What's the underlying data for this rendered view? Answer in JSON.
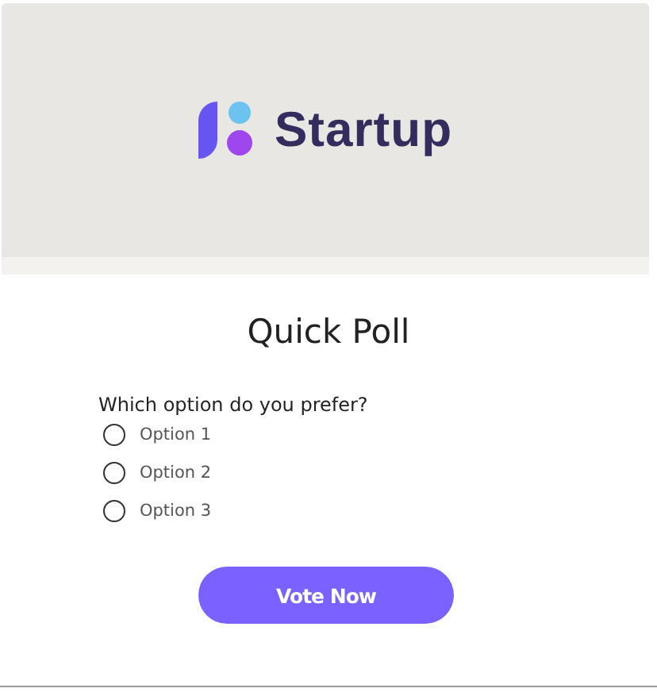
{
  "header": {
    "brand": "Startup"
  },
  "poll": {
    "title": "Quick Poll",
    "question": "Which option do you prefer?",
    "options": [
      {
        "label": "Option 1",
        "selected": false
      },
      {
        "label": "Option 2",
        "selected": false
      },
      {
        "label": "Option 3",
        "selected": false
      }
    ],
    "button": "Vote Now"
  }
}
